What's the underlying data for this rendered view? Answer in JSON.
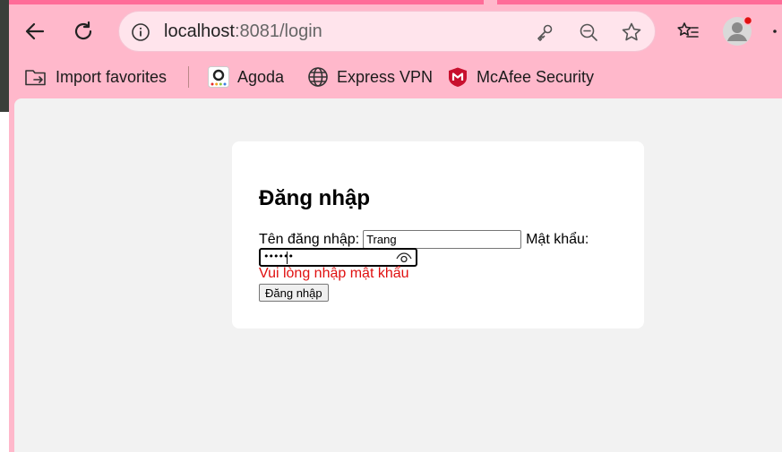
{
  "browser": {
    "address": {
      "host": "localhost",
      "path": ":8081/login"
    },
    "bookmarks": [
      {
        "label": "Import favorites",
        "icon": "import-folder-icon"
      },
      {
        "label": "Agoda",
        "icon": "agoda-logo-icon"
      },
      {
        "label": "Express VPN",
        "icon": "globe-icon"
      },
      {
        "label": "McAfee Security",
        "icon": "mcafee-shield-icon"
      }
    ],
    "colors": {
      "frame": "#ffb8cb",
      "address_bar": "#ffe4ec",
      "tab_accent": "#ff6c98",
      "profile_badge": "#e01010"
    }
  },
  "page": {
    "title": "Đăng nhập",
    "username_label": "Tên đăng nhập:",
    "username_value": "Trang",
    "password_label": "Mật khẩu:",
    "password_masked": "••••••",
    "error_message": "Vui lòng nhập mật khẩu",
    "submit_label": "Đăng nhập",
    "colors": {
      "error": "#e01010",
      "background": "#f2f2f2",
      "card": "#ffffff"
    }
  }
}
